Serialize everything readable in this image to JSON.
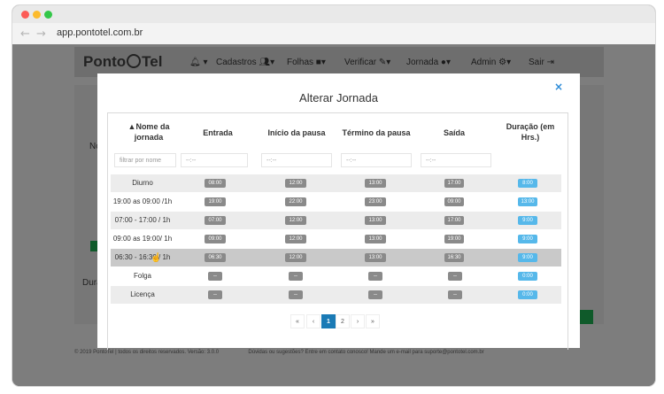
{
  "browser": {
    "url": "app.pontotel.com.br"
  },
  "app": {
    "logo_left": "Ponto",
    "logo_right": "Tel",
    "menu": [
      "Cadastros",
      "Folhas",
      "Verificar",
      "Jornada",
      "Admin",
      "Sair"
    ],
    "side_labels": [
      "No",
      "Dura"
    ],
    "footer_left": "© 2019 PontoTel | todos os direitos reservados. Versão: 3.0.0",
    "footer_right": "Dúvidas ou sugestões? Entre em contato conosco! Mande um e-mail para suporte@pontotel.com.br"
  },
  "modal": {
    "title": "Alterar Jornada",
    "close_icon": "×",
    "columns": [
      "▲Nome da jornada",
      "Entrada",
      "Início da pausa",
      "Término da pausa",
      "Saída",
      "Duração (em Hrs.)"
    ],
    "filter_placeholders": [
      "filtrar por nome",
      "--:--",
      "--:--",
      "--:--",
      "--:--"
    ],
    "rows": [
      {
        "name": "Diurno",
        "entrada": "08:00",
        "inicio": "12:00",
        "termino": "13:00",
        "saida": "17:00",
        "duracao": "8:00"
      },
      {
        "name": "19:00 as 09:00 /1h",
        "entrada": "19:00",
        "inicio": "22:00",
        "termino": "23:00",
        "saida": "09:00",
        "duracao": "13:00"
      },
      {
        "name": "07:00 - 17:00 / 1h",
        "entrada": "07:00",
        "inicio": "12:00",
        "termino": "13:00",
        "saida": "17:00",
        "duracao": "9:00"
      },
      {
        "name": "09:00 as 19:00/ 1h",
        "entrada": "09:00",
        "inicio": "12:00",
        "termino": "13:00",
        "saida": "19:00",
        "duracao": "9:00"
      },
      {
        "name": "06:30 - 16:30 / 1h",
        "entrada": "06:30",
        "inicio": "12:00",
        "termino": "13:00",
        "saida": "16:30",
        "duracao": "9:00"
      },
      {
        "name": "Folga",
        "entrada": "--",
        "inicio": "--",
        "termino": "--",
        "saida": "--",
        "duracao": "0:00"
      },
      {
        "name": "Licença",
        "entrada": "--",
        "inicio": "--",
        "termino": "--",
        "saida": "--",
        "duracao": "0:00"
      }
    ],
    "pagination": [
      "«",
      "‹",
      "1",
      "2",
      "›",
      "»"
    ]
  }
}
